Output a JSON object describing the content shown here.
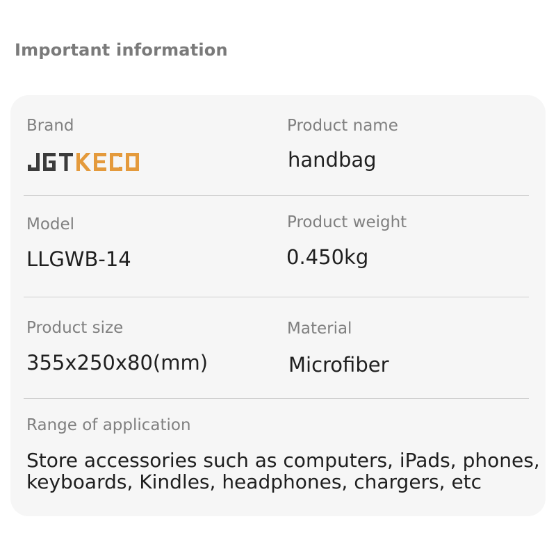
{
  "heading": "Important information",
  "brand": {
    "label": "Brand",
    "logo_text": "JGTKECO",
    "logo_colors": {
      "dark": "#3b3b3b",
      "accent": "#e49a3c"
    }
  },
  "product_name": {
    "label": "Product name",
    "value": "handbag"
  },
  "model": {
    "label": "Model",
    "value": "LLGWB-14"
  },
  "product_weight": {
    "label": "Product weight",
    "value": "0.450kg"
  },
  "product_size": {
    "label": "Product size",
    "value": "355x250x80(mm)"
  },
  "material": {
    "label": "Material",
    "value": "Microfiber"
  },
  "range_of_application": {
    "label": "Range of application",
    "value": "Store accessories such as computers, iPads, phones,\nkeyboards, Kindles, headphones, chargers, etc"
  },
  "colors": {
    "card_background": "#f6f6f6",
    "divider": "#cfcfcf"
  }
}
